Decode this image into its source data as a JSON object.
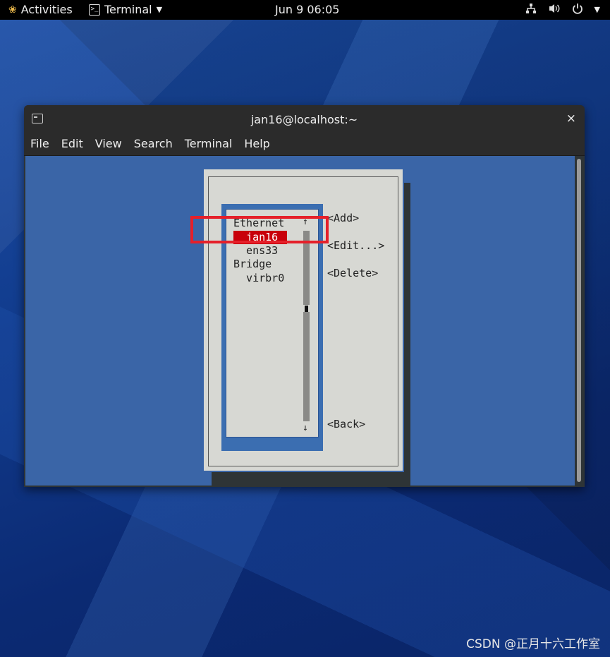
{
  "topbar": {
    "activities": "Activities",
    "app_menu": "Terminal",
    "clock": "Jun 9  06:05"
  },
  "window": {
    "title": "jan16@localhost:~",
    "close_glyph": "×",
    "menu": [
      "File",
      "Edit",
      "View",
      "Search",
      "Terminal",
      "Help"
    ]
  },
  "nmtui": {
    "list": {
      "ethernet_header": "Ethernet",
      "selected_item": "  jan16",
      "ens_item": "  ens33",
      "bridge_header": "Bridge",
      "virbr_item": "  virbr0",
      "up_arrow": "↑",
      "down_arrow": "↓"
    },
    "buttons": {
      "add": "<Add>",
      "edit": "<Edit...>",
      "delete": "<Delete>",
      "back": "<Back>"
    }
  },
  "watermark": "CSDN @正月十六工作室",
  "colors": {
    "terminal_bg": "#3a65a7",
    "selection": "#c8000a",
    "annotation": "#e5202a",
    "dialog_bg": "#d7d8d3"
  }
}
